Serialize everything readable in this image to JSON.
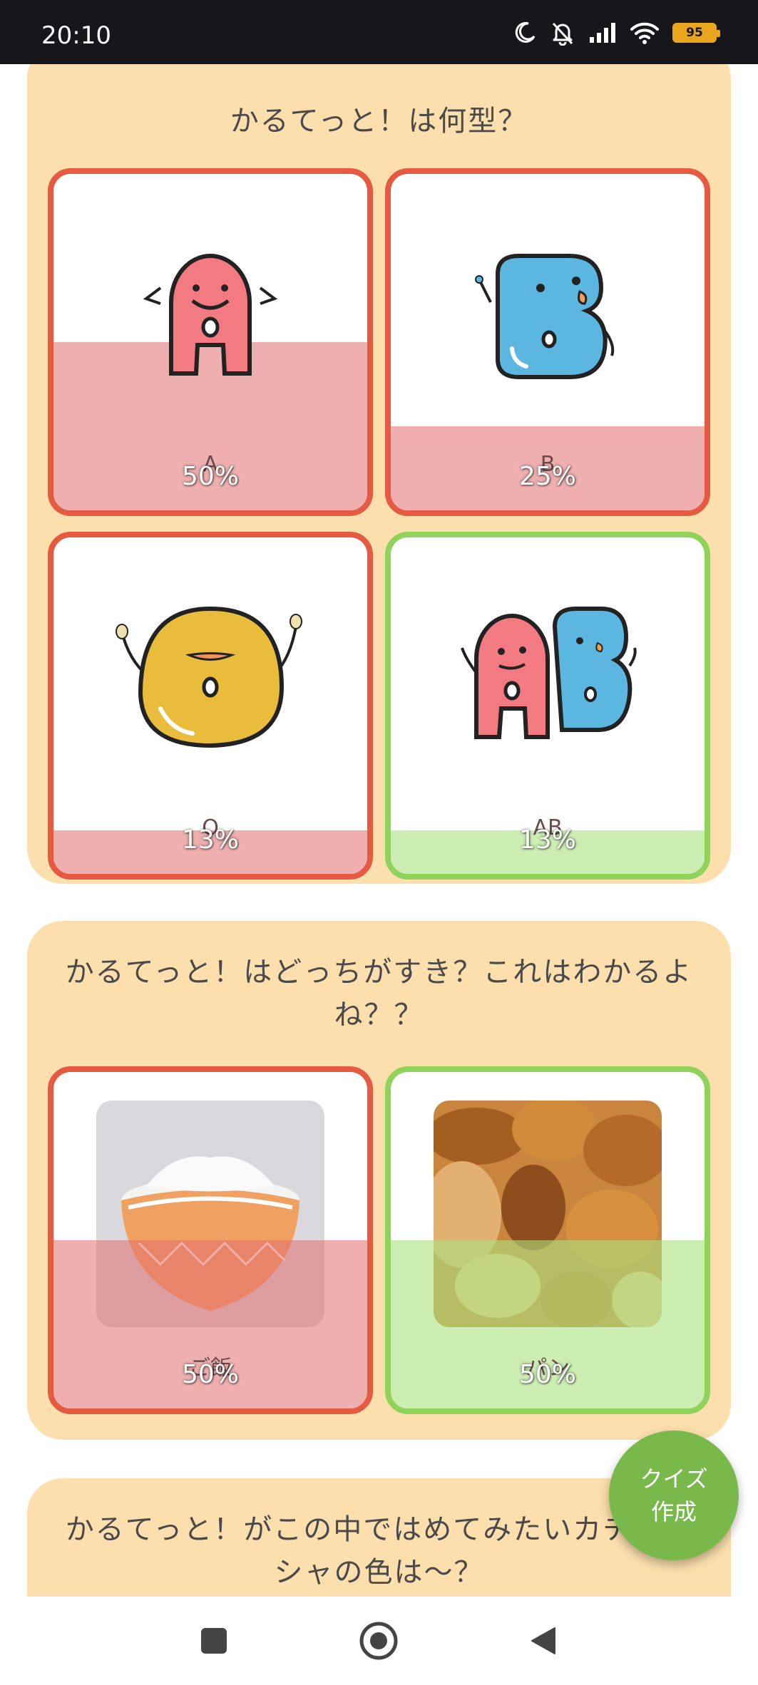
{
  "status_bar": {
    "time": "20:10",
    "battery_level": "95",
    "icons": [
      "moon-icon",
      "bell-off-icon",
      "signal-icon",
      "wifi-icon",
      "battery-icon"
    ]
  },
  "quizzes": [
    {
      "title": "かるてっと！は何型？",
      "options": [
        {
          "label": "A",
          "percent": "50%",
          "fraction": 0.5,
          "selected": true,
          "correct": false,
          "image": "blood-type-a-character"
        },
        {
          "label": "B",
          "percent": "25%",
          "fraction": 0.25,
          "selected": false,
          "correct": false,
          "image": "blood-type-b-character"
        },
        {
          "label": "O",
          "percent": "13%",
          "fraction": 0.13,
          "selected": false,
          "correct": false,
          "image": "blood-type-o-character"
        },
        {
          "label": "AB",
          "percent": "13%",
          "fraction": 0.13,
          "selected": false,
          "correct": true,
          "image": "blood-type-ab-character"
        }
      ]
    },
    {
      "title": "かるてっと！はどっちがすき？これはわかるよね？？",
      "options": [
        {
          "label": "ご飯",
          "percent": "50%",
          "fraction": 0.5,
          "selected": true,
          "correct": false,
          "image": "rice-bowl-photo"
        },
        {
          "label": "パン",
          "percent": "50%",
          "fraction": 0.5,
          "selected": false,
          "correct": true,
          "image": "bread-photo"
        }
      ]
    },
    {
      "title": "かるてっと！がこの中ではめてみたいカチューシャの色は〜？"
    }
  ],
  "fab": {
    "line1": "クイズ",
    "line2": "作成"
  },
  "nav_bar": {
    "icons": [
      "recents-square-icon",
      "home-circle-icon",
      "back-triangle-icon"
    ]
  },
  "colors": {
    "status_bg": "#16161b",
    "card_bg": "#fddfae",
    "wrong_border": "#e55a41",
    "correct_border": "#8fd35b",
    "wrong_fill": "#e26e6e",
    "correct_fill": "#aae280",
    "fab_bg": "#79b84a",
    "battery": "#e9a61d"
  }
}
